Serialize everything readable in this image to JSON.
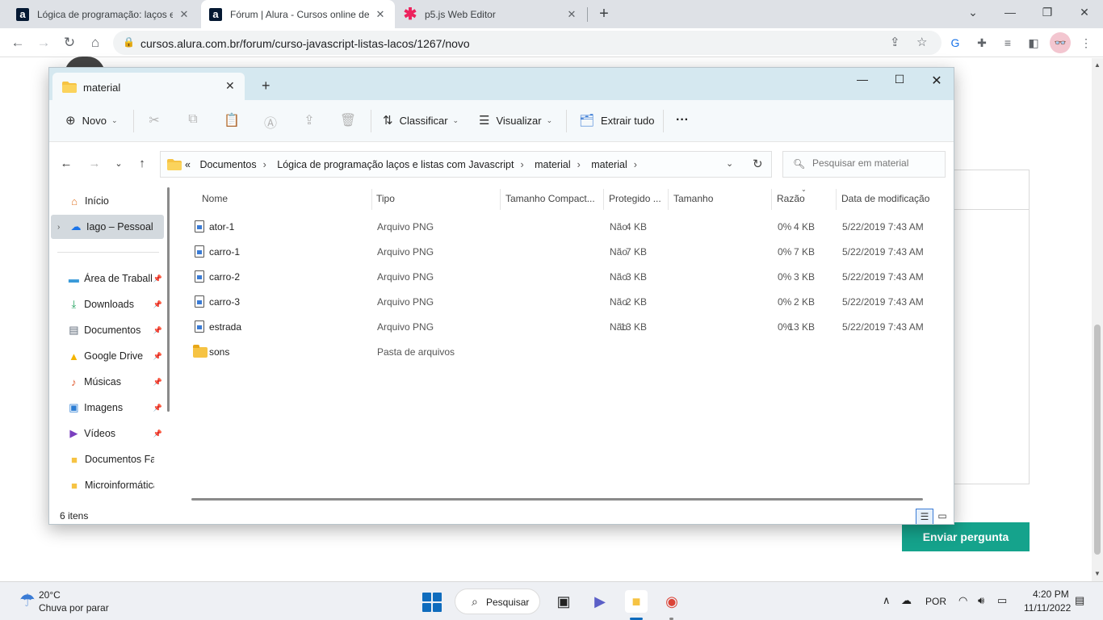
{
  "browser": {
    "tabs": [
      {
        "title": "Lógica de programação: laços e l",
        "favicon": "a"
      },
      {
        "title": "Fórum | Alura - Cursos online de",
        "favicon": "a"
      },
      {
        "title": "p5.js Web Editor",
        "favicon": "✱"
      }
    ],
    "new_tab": "+",
    "url": "cursos.alura.com.br/forum/curso-javascript-listas-lacos/1267/novo",
    "profile_initials": "👓"
  },
  "page": {
    "submit_label": "Enviar pergunta",
    "submit_color": "#15a38c"
  },
  "explorer": {
    "tab_title": "material",
    "commands": {
      "new": "Novo",
      "sort": "Classificar",
      "view": "Visualizar",
      "extract": "Extrair tudo",
      "more": "···"
    },
    "breadcrumb": {
      "overflow": "«",
      "items": [
        "Documentos",
        "Lógica de programação laços e listas com Javascript",
        "material",
        "material"
      ]
    },
    "search_placeholder": "Pesquisar em material",
    "nav": {
      "home": "Início",
      "onedrive": "Iago – Pessoal",
      "pinned": [
        {
          "label": "Área de Trabalho",
          "icon": "desktop-icon"
        },
        {
          "label": "Downloads",
          "icon": "download-icon"
        },
        {
          "label": "Documentos",
          "icon": "documents-icon"
        },
        {
          "label": "Google Drive",
          "icon": "google-drive-icon"
        },
        {
          "label": "Músicas",
          "icon": "music-icon"
        },
        {
          "label": "Imagens",
          "icon": "pictures-icon"
        },
        {
          "label": "Vídeos",
          "icon": "videos-icon"
        },
        {
          "label": "Documentos Fatec",
          "icon": "folder-icon"
        },
        {
          "label": "Microinformática",
          "icon": "folder-icon"
        }
      ]
    },
    "columns": [
      "Nome",
      "Tipo",
      "Tamanho Compact...",
      "Protegido ...",
      "Tamanho",
      "Razão",
      "Data de modificação"
    ],
    "files": [
      {
        "name": "ator-1",
        "type": "Arquivo PNG",
        "packed": "4 KB",
        "protected": "Não",
        "size": "4 KB",
        "ratio": "0%",
        "modified": "5/22/2019 7:43 AM",
        "kind": "file"
      },
      {
        "name": "carro-1",
        "type": "Arquivo PNG",
        "packed": "7 KB",
        "protected": "Não",
        "size": "7 KB",
        "ratio": "0%",
        "modified": "5/22/2019 7:43 AM",
        "kind": "file"
      },
      {
        "name": "carro-2",
        "type": "Arquivo PNG",
        "packed": "3 KB",
        "protected": "Não",
        "size": "3 KB",
        "ratio": "0%",
        "modified": "5/22/2019 7:43 AM",
        "kind": "file"
      },
      {
        "name": "carro-3",
        "type": "Arquivo PNG",
        "packed": "2 KB",
        "protected": "Não",
        "size": "2 KB",
        "ratio": "0%",
        "modified": "5/22/2019 7:43 AM",
        "kind": "file"
      },
      {
        "name": "estrada",
        "type": "Arquivo PNG",
        "packed": "13 KB",
        "protected": "Não",
        "size": "13 KB",
        "ratio": "0%",
        "modified": "5/22/2019 7:43 AM",
        "kind": "file"
      },
      {
        "name": "sons",
        "type": "Pasta de arquivos",
        "packed": "",
        "protected": "",
        "size": "",
        "ratio": "",
        "modified": "",
        "kind": "folder"
      }
    ],
    "status": "6 itens"
  },
  "taskbar": {
    "temperature": "20°C",
    "weather": "Chuva por parar",
    "search": "Pesquisar",
    "language": "POR",
    "time": "4:20 PM",
    "date": "11/11/2022"
  }
}
